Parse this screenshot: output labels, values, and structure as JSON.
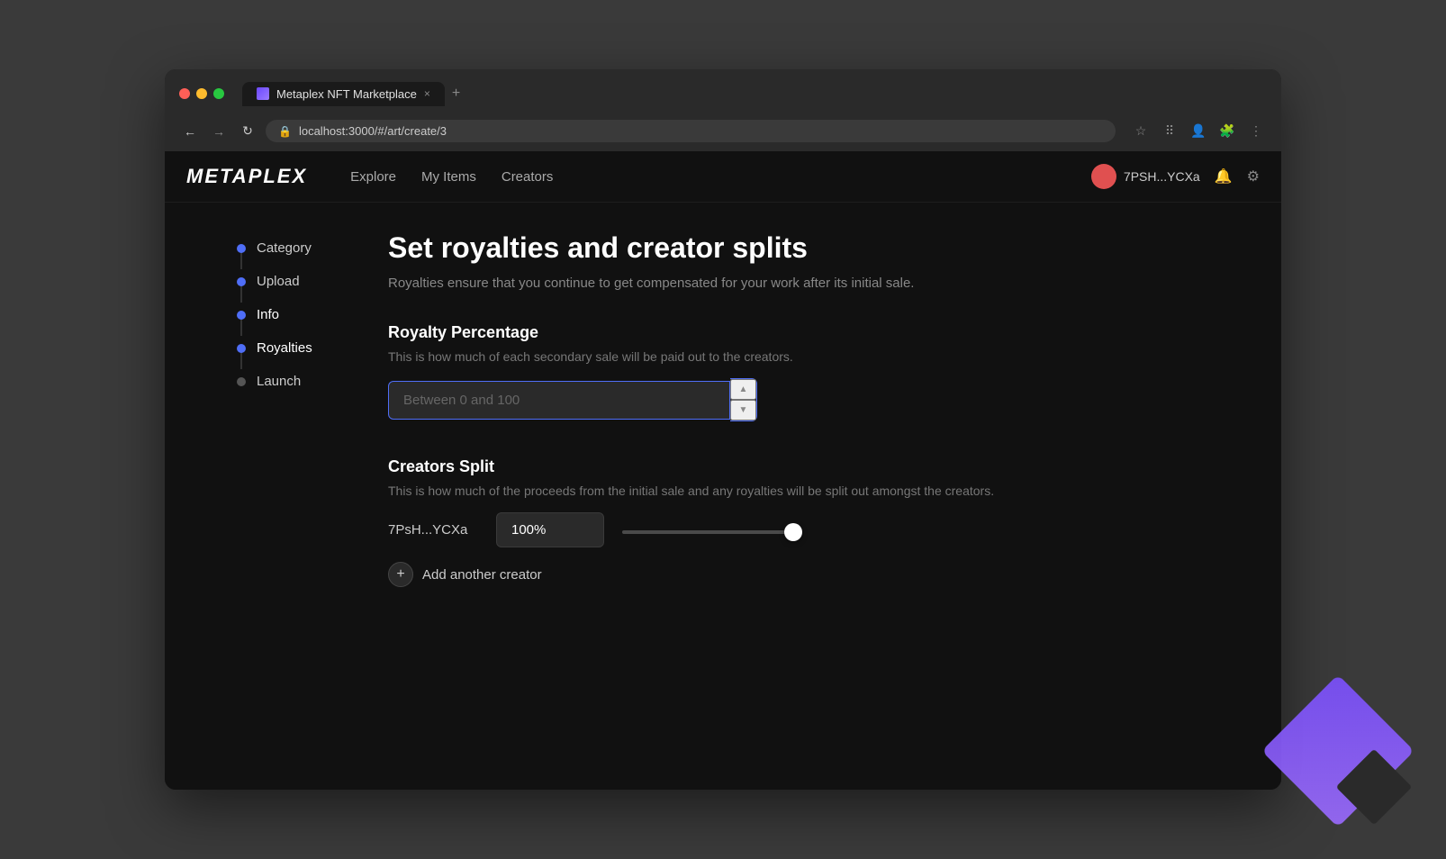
{
  "browser": {
    "traffic_lights": [
      "red",
      "yellow",
      "green"
    ],
    "tab_title": "Metaplex NFT Marketplace",
    "tab_close": "×",
    "tab_new": "+",
    "address": "localhost:3000/#/art/create/3",
    "nav_back": "←",
    "nav_forward": "→",
    "nav_refresh": "↻"
  },
  "nav": {
    "logo": "METAPLEX",
    "links": [
      "Explore",
      "My Items",
      "Creators"
    ],
    "user_address": "7PSH...YCXa",
    "bell_icon": "🔔",
    "settings_icon": "⚙"
  },
  "steps": [
    {
      "id": "category",
      "label": "Category",
      "state": "completed"
    },
    {
      "id": "upload",
      "label": "Upload",
      "state": "completed"
    },
    {
      "id": "info",
      "label": "Info",
      "state": "active"
    },
    {
      "id": "royalties",
      "label": "Royalties",
      "state": "active"
    },
    {
      "id": "launch",
      "label": "Launch",
      "state": "pending"
    }
  ],
  "page": {
    "title": "Set royalties and creator splits",
    "subtitle": "Royalties ensure that you continue to get compensated for your work after its initial sale."
  },
  "royalty_section": {
    "title": "Royalty Percentage",
    "description": "This is how much of each secondary sale will be paid out to the creators.",
    "input_placeholder": "Between 0 and 100",
    "input_value": ""
  },
  "creators_section": {
    "title": "Creators Split",
    "description": "This is how much of the proceeds from the initial sale and any royalties will be split out amongst the creators.",
    "creators": [
      {
        "address": "7PsH...YCXa",
        "percent": "100%",
        "slider_value": 100
      }
    ],
    "add_creator_label": "Add another creator"
  }
}
